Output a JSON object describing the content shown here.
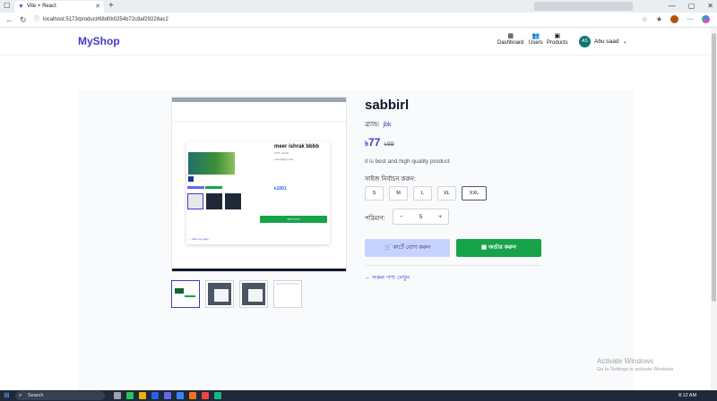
{
  "browser": {
    "tab_title": "Vite + React",
    "url": "localhost:5173/product/68d0b0254b72c8af29228ac2",
    "favicon": "vite-icon"
  },
  "header": {
    "logo": "MyShop",
    "nav": [
      {
        "label": "Dashboard",
        "icon": "grid-icon"
      },
      {
        "label": "Users",
        "icon": "users-icon"
      },
      {
        "label": "Products",
        "icon": "box-icon"
      }
    ],
    "user": {
      "initials": "AS",
      "name": "Abu saad"
    }
  },
  "product": {
    "title": "sabbirl",
    "brand_label": "ব্র্যান্ড:",
    "brand_value": "jbk",
    "currency": "৳",
    "price": "77",
    "old_price": "99",
    "description": "it is best and high quality product",
    "size_label": "সাইজ নির্বাচন করুন:",
    "sizes": [
      "S",
      "M",
      "L",
      "XL",
      "XXL"
    ],
    "selected_size": "XXL",
    "quantity_label": "পরিমাণ:",
    "quantity": "5",
    "add_to_cart": "কার্টে যোগ করুন",
    "order": "অর্ডার করুন",
    "back_link": "← সকল পণ্য দেখুন"
  },
  "main_image": {
    "card_title": "meer ishrak bbbb",
    "card_brand": "ব্র্যান্ড: cnsrts",
    "card_desc": "I am happy now",
    "card_price": "৳1001",
    "order_text": "অর্ডার করুন",
    "back_link": "← View mo pogs"
  },
  "watermark": {
    "line1": "Activate Windows",
    "line2": "Go to Settings to activate Windows."
  },
  "taskbar": {
    "search": "Search",
    "time": "8:12 AM"
  },
  "colors": {
    "brand": "#4338ca",
    "order_green": "#16a34a",
    "cart_bg": "#c7d2fe"
  }
}
